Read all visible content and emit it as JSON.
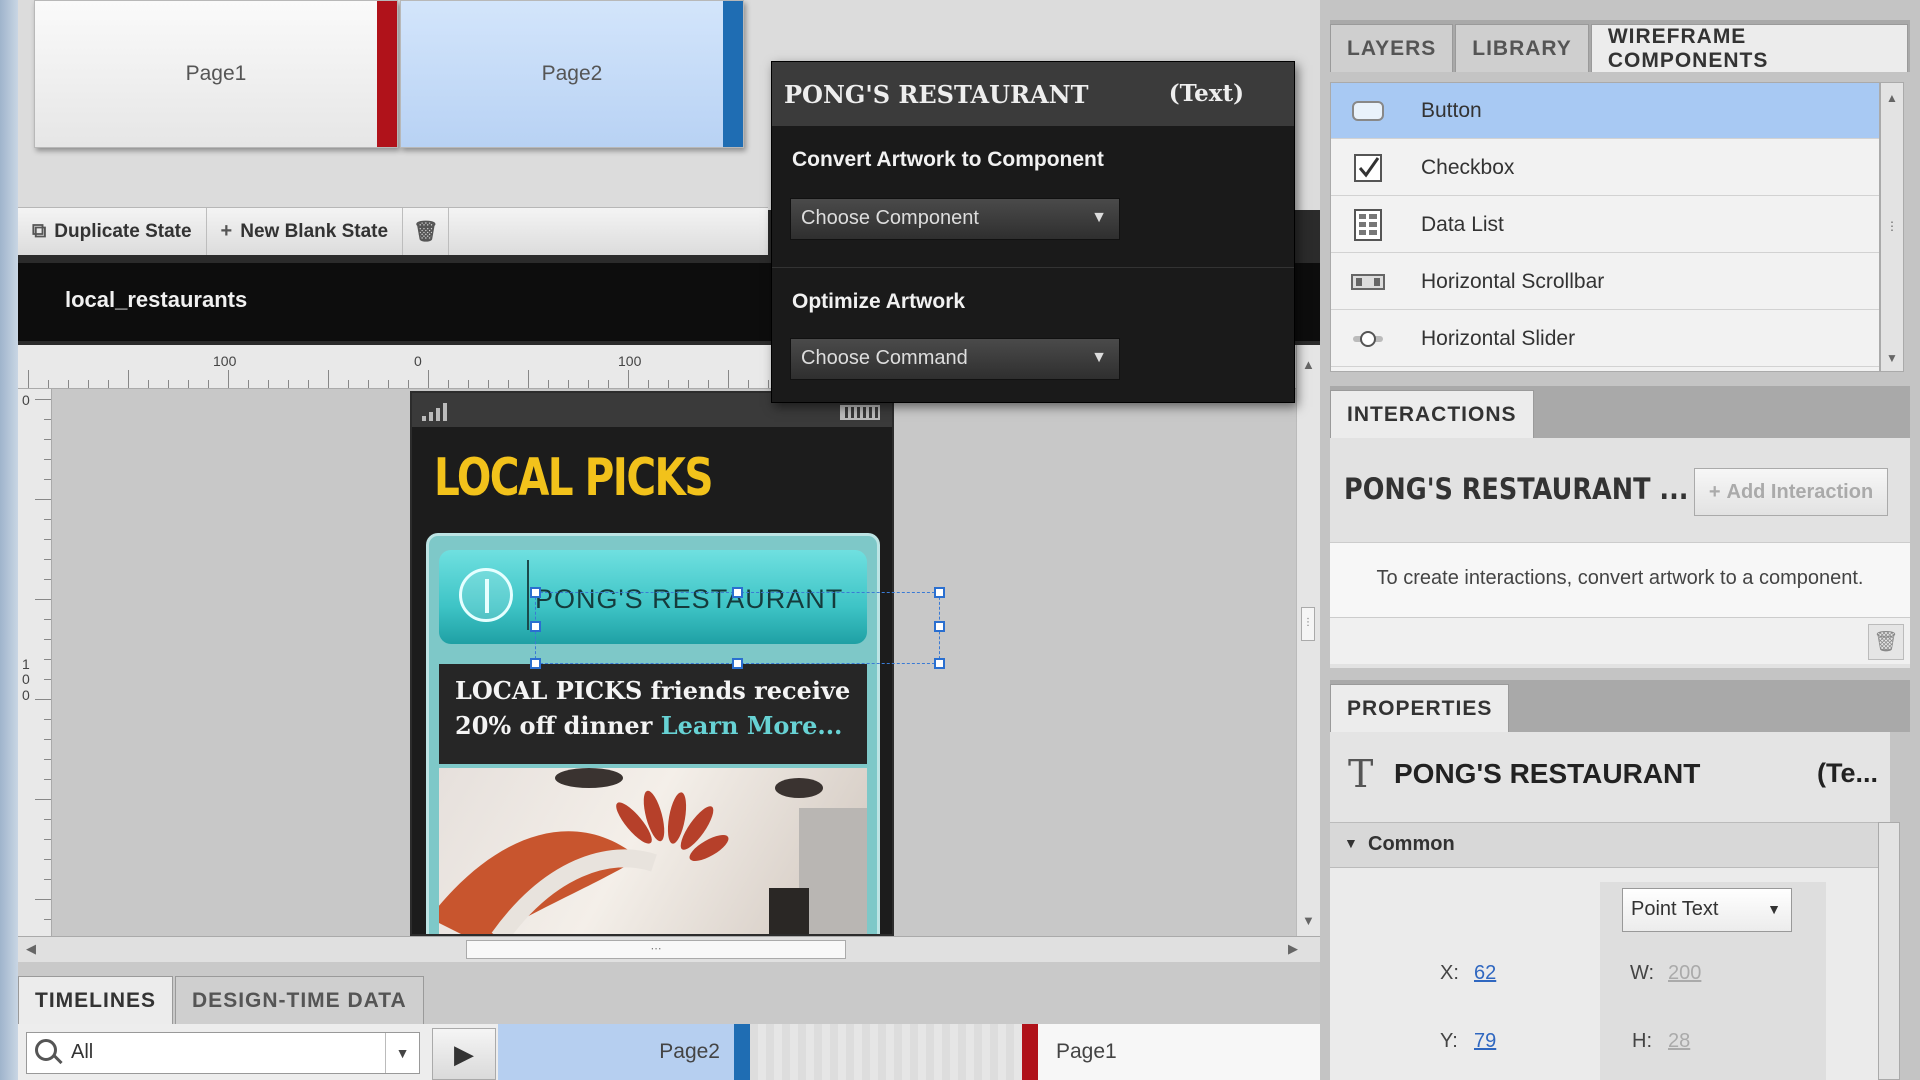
{
  "states": {
    "pages": [
      {
        "label": "Page1"
      },
      {
        "label": "Page2"
      }
    ],
    "toolbar": {
      "duplicate_label": "Duplicate State",
      "new_blank_label": "New Blank State"
    }
  },
  "artboard": {
    "name": "local_restaurants",
    "ruler_top_labels": [
      "100",
      "0",
      "100"
    ],
    "ruler_left_labels": [
      "0",
      "1\n0\n0"
    ]
  },
  "phone": {
    "brand": "LOCAL PICKS",
    "restaurant": "PONG'S RESTAURANT",
    "promo_text": "LOCAL PICKS friends receive 20% off dinner",
    "promo_link": "Learn More..."
  },
  "popup": {
    "title": "PONG'S RESTAURANT",
    "type": "(Text)",
    "convert_label": "Convert Artwork to Component",
    "convert_select": "Choose Component",
    "optimize_label": "Optimize Artwork",
    "optimize_select": "Choose Command"
  },
  "right_panel": {
    "tabs": [
      {
        "label": "LAYERS"
      },
      {
        "label": "LIBRARY"
      },
      {
        "label": "WIREFRAME COMPONENTS"
      }
    ],
    "components": [
      {
        "label": "Button",
        "icon": "button-icon"
      },
      {
        "label": "Checkbox",
        "icon": "checkbox-icon"
      },
      {
        "label": "Data List",
        "icon": "data-list-icon"
      },
      {
        "label": "Horizontal Scrollbar",
        "icon": "horizontal-scrollbar-icon"
      },
      {
        "label": "Horizontal Slider",
        "icon": "horizontal-slider-icon"
      }
    ],
    "interactions": {
      "tab": "INTERACTIONS",
      "target": "PONG'S RESTAURANT ...",
      "add_label": "Add Interaction",
      "help": "To create interactions, convert artwork to a component."
    },
    "properties": {
      "tab": "PROPERTIES",
      "title": "PONG'S RESTAURANT",
      "type": "(Te...",
      "section": "Common",
      "text_mode": "Point Text",
      "x_label": "X:",
      "x_value": "62",
      "y_label": "Y:",
      "y_value": "79",
      "w_label": "W:",
      "w_value": "200",
      "h_label": "H:",
      "h_value": "28"
    }
  },
  "timelines": {
    "tabs": [
      {
        "label": "TIMELINES"
      },
      {
        "label": "DESIGN-TIME DATA"
      }
    ],
    "filter": "All",
    "page2": "Page2",
    "page1": "Page1"
  },
  "colors": {
    "brand_yellow": "#f2c21b",
    "teal": "#3ec4c6",
    "selection_blue": "#a8c9f3",
    "page1_marker": "#b0121a",
    "page2_marker": "#1f6db3"
  }
}
